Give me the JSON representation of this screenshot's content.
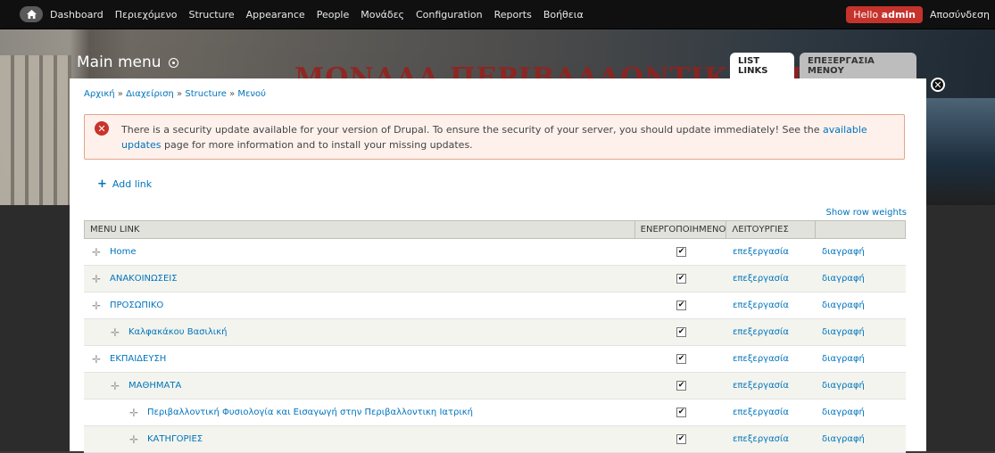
{
  "toolbar": {
    "items": [
      "Dashboard",
      "Περιεχόμενο",
      "Structure",
      "Appearance",
      "People",
      "Μονάδες",
      "Configuration",
      "Reports",
      "Βοήθεια"
    ],
    "hello_prefix": "Hello ",
    "user": "admin",
    "logout": "Αποσύνδεση"
  },
  "background_title": "ΜΟΝΑΔΑ ΠΕΡΙΒΑΛΛΟΝΤΙΚΗΣ ΦΥΣΙΟΛ",
  "overlay": {
    "title": "Main menu",
    "tabs": [
      "LIST LINKS",
      "ΕΠΕΞΕΡΓΑΣΙΑ ΜΕΝΟΥ"
    ]
  },
  "breadcrumb": [
    "Αρχική",
    "Διαχείριση",
    "Structure",
    "Μενού"
  ],
  "breadcrumb_sep": " » ",
  "message": {
    "before": "There is a security update available for your version of Drupal. To ensure the security of your server, you should update immediately! See the ",
    "link": "available updates",
    "after": " page for more information and to install your missing updates."
  },
  "add_link": "Add link",
  "show_row_weights": "Show row weights",
  "table": {
    "headers": [
      "MENU LINK",
      "ΕΝΕΡΓΟΠΟΙΗΜΕΝΟ",
      "ΛΕΙΤΟΥΡΓΙΕΣ",
      ""
    ],
    "rows": [
      {
        "title": "Home",
        "depth": 0,
        "enabled": true,
        "edit": "επεξεργασία",
        "delete": "διαγραφή"
      },
      {
        "title": "ΑΝΑΚΟΙΝΩΣΕΙΣ",
        "depth": 0,
        "enabled": true,
        "edit": "επεξεργασία",
        "delete": "διαγραφή"
      },
      {
        "title": "ΠΡΟΣΩΠΙΚΟ",
        "depth": 0,
        "enabled": true,
        "edit": "επεξεργασία",
        "delete": "διαγραφή"
      },
      {
        "title": "Καλφακάκου Βασιλική",
        "depth": 1,
        "enabled": true,
        "edit": "επεξεργασία",
        "delete": "διαγραφή"
      },
      {
        "title": "ΕΚΠΑΙΔΕΥΣΗ",
        "depth": 0,
        "enabled": true,
        "edit": "επεξεργασία",
        "delete": "διαγραφή"
      },
      {
        "title": "ΜΑΘΗΜΑΤΑ",
        "depth": 1,
        "enabled": true,
        "edit": "επεξεργασία",
        "delete": "διαγραφή"
      },
      {
        "title": "Περιβαλλοντική Φυσιολογία και Εισαγωγή στην Περιβαλλοντικη Ιατρική",
        "depth": 2,
        "enabled": true,
        "edit": "επεξεργασία",
        "delete": "διαγραφή"
      },
      {
        "title": "ΚΑΤΗΓΟΡΙΕΣ",
        "depth": 2,
        "enabled": true,
        "edit": "επεξεργασία",
        "delete": "διαγραφή"
      }
    ]
  }
}
